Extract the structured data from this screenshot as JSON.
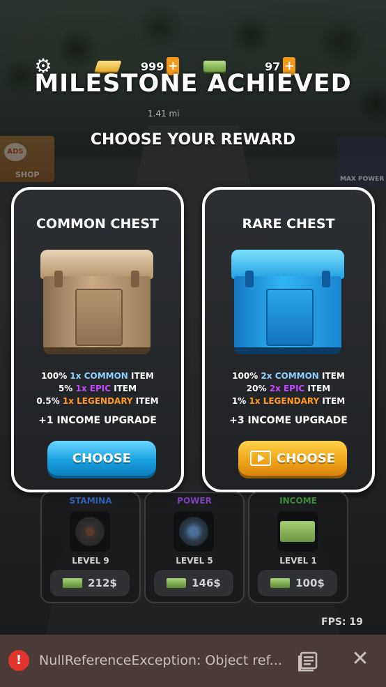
{
  "hud": {
    "gold_value": "999",
    "cash_value": "97",
    "plus_label": "+",
    "distance": "1.41 mi",
    "shop_ads": "ADS",
    "shop_label": "SHOP",
    "max_power_label": "MAX POWER"
  },
  "dialog": {
    "title": "MILESTONE ACHIEVED",
    "subtitle": "CHOOSE YOUR REWARD"
  },
  "chests": [
    {
      "name": "COMMON CHEST",
      "odds": [
        {
          "pct": "100%",
          "qty": "1x",
          "rarity": "COMMON",
          "suffix": "ITEM"
        },
        {
          "pct": "5%",
          "qty": "1x",
          "rarity": "EPIC",
          "suffix": "ITEM"
        },
        {
          "pct": "0.5%",
          "qty": "1x",
          "rarity": "LEGENDARY",
          "suffix": "ITEM"
        }
      ],
      "upgrade": "+1 INCOME UPGRADE",
      "button": "CHOOSE",
      "button_icon": "none"
    },
    {
      "name": "RARE CHEST",
      "odds": [
        {
          "pct": "100%",
          "qty": "2x",
          "rarity": "COMMON",
          "suffix": "ITEM"
        },
        {
          "pct": "20%",
          "qty": "2x",
          "rarity": "EPIC",
          "suffix": "ITEM"
        },
        {
          "pct": "1%",
          "qty": "1x",
          "rarity": "LEGENDARY",
          "suffix": "ITEM"
        }
      ],
      "upgrade": "+3 INCOME UPGRADE",
      "button": "CHOOSE",
      "button_icon": "video-icon"
    }
  ],
  "stats": [
    {
      "label": "STAMINA",
      "label_color": "#2f5fb0",
      "level": "LEVEL 9",
      "price": "212$",
      "icon": "fan-icon"
    },
    {
      "label": "POWER",
      "label_color": "#7a3fb5",
      "level": "LEVEL 5",
      "price": "146$",
      "icon": "turbo-icon"
    },
    {
      "label": "INCOME",
      "label_color": "#3d8a3d",
      "level": "LEVEL 1",
      "price": "100$",
      "icon": "cash-stack-icon"
    }
  ],
  "fps": "FPS: 19",
  "error": {
    "icon": "!",
    "message": "NullReferenceException: Object ref..."
  },
  "colors": {
    "common": "#8ed2ff",
    "epic": "#c249ff",
    "legendary": "#ff9a1f",
    "button_blue": "#1aa3e0",
    "button_orange": "#f1a61b",
    "error_red": "#e1342c"
  }
}
